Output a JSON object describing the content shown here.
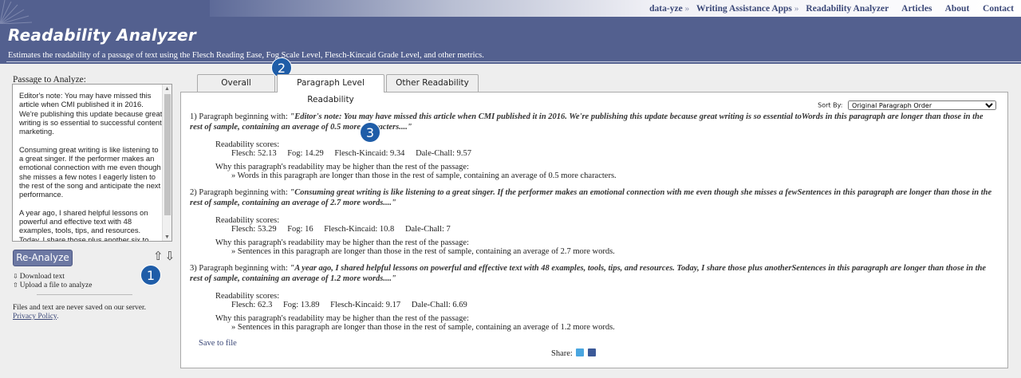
{
  "nav": {
    "links": [
      "data-yze",
      "Writing Assistance Apps",
      "Readability Analyzer",
      "Articles",
      "About",
      "Contact"
    ],
    "separator": "»"
  },
  "header": {
    "title": "Readability Analyzer",
    "subtitle": "Estimates the readability of a passage of text using the Flesch Reading Ease, Fog Scale Level, Flesch-Kincaid Grade Level, and other metrics."
  },
  "left": {
    "label": "Passage to Analyze:",
    "passage": "Editor's note: You may have missed this article when CMI published it in 2016. We're publishing this  update  because great writing is so essential to successful content marketing.\n\nConsuming great writing is like listening to a great singer. If the performer makes an emotional connection  with me     even though she misses a few notes    I eagerly listen to the rest of the song and anticipate the next performance.\n\nA year ago, I shared helpful lessons on powerful and effective text with  48 examples, tools, tips, and resources. Today, I share those plus another six to help you win over as many of your readers as possible.",
    "reanalyze_label": "Re-Analyze",
    "updown_glyph": "⇧⇩",
    "download_icon": "⇩",
    "download_label": "Download text",
    "upload_icon": "⇧",
    "upload_label": "Upload a file to analyze",
    "note": "Files and text are never saved on our server.",
    "privacy_label": "Privacy Policy",
    "privacy_suffix": "."
  },
  "tabs": [
    {
      "label": "Overall Readability"
    },
    {
      "label": "Paragraph Level Readability"
    },
    {
      "label": "Other Readability Tools"
    }
  ],
  "panel": {
    "sort_label": "Sort By:",
    "sort_selected": "Original Paragraph Order",
    "scores_label": "Readability scores:",
    "why_label": "Why this paragraph's readability may be higher than the rest of the passage:",
    "paragraphs": [
      {
        "prefix": "1) Paragraph beginning with:",
        "quote": "\"Editor's note: You may have missed this article when CMI published it in 2016. We're publishing this update because great writing is so essential toWords in this paragraph are longer than those in the rest of sample, containing an average of 0.5 more characters....\"",
        "flesch": "Flesch: 52.13",
        "fog": "Fog: 14.29",
        "fk": "Flesch-Kincaid: 9.34",
        "dc": "Dale-Chall: 9.57",
        "reason": "» Words in this paragraph are longer than those in the rest of sample, containing an average of 0.5 more characters."
      },
      {
        "prefix": "2) Paragraph beginning with:",
        "quote": "\"Consuming great writing is like listening to a great singer. If the performer makes an emotional connection with me even though she misses a fewSentences in this paragraph are longer than those in the rest of sample, containing an average of 2.7 more words....\"",
        "flesch": "Flesch: 53.29",
        "fog": "Fog: 16",
        "fk": "Flesch-Kincaid: 10.8",
        "dc": "Dale-Chall: 7",
        "reason": "» Sentences in this paragraph are longer than those in the rest of sample, containing an average of 2.7 more words."
      },
      {
        "prefix": "3) Paragraph beginning with:",
        "quote": "\"A year ago, I shared helpful lessons on powerful and effective text with 48 examples, tools, tips, and resources. Today, I share those plus anotherSentences in this paragraph are longer than those in the rest of sample, containing an average of 1.2 more words....\"",
        "flesch": "Flesch: 62.3",
        "fog": "Fog: 13.89",
        "fk": "Flesch-Kincaid: 9.17",
        "dc": "Dale-Chall: 6.69",
        "reason": "» Sentences in this paragraph are longer than those in the rest of sample, containing an average of 1.2 more words."
      }
    ],
    "save_label": "Save to file",
    "share_label": "Share:",
    "share_icons": [
      "twitter-icon",
      "facebook-icon"
    ]
  },
  "markers": [
    "1",
    "2",
    "3"
  ]
}
